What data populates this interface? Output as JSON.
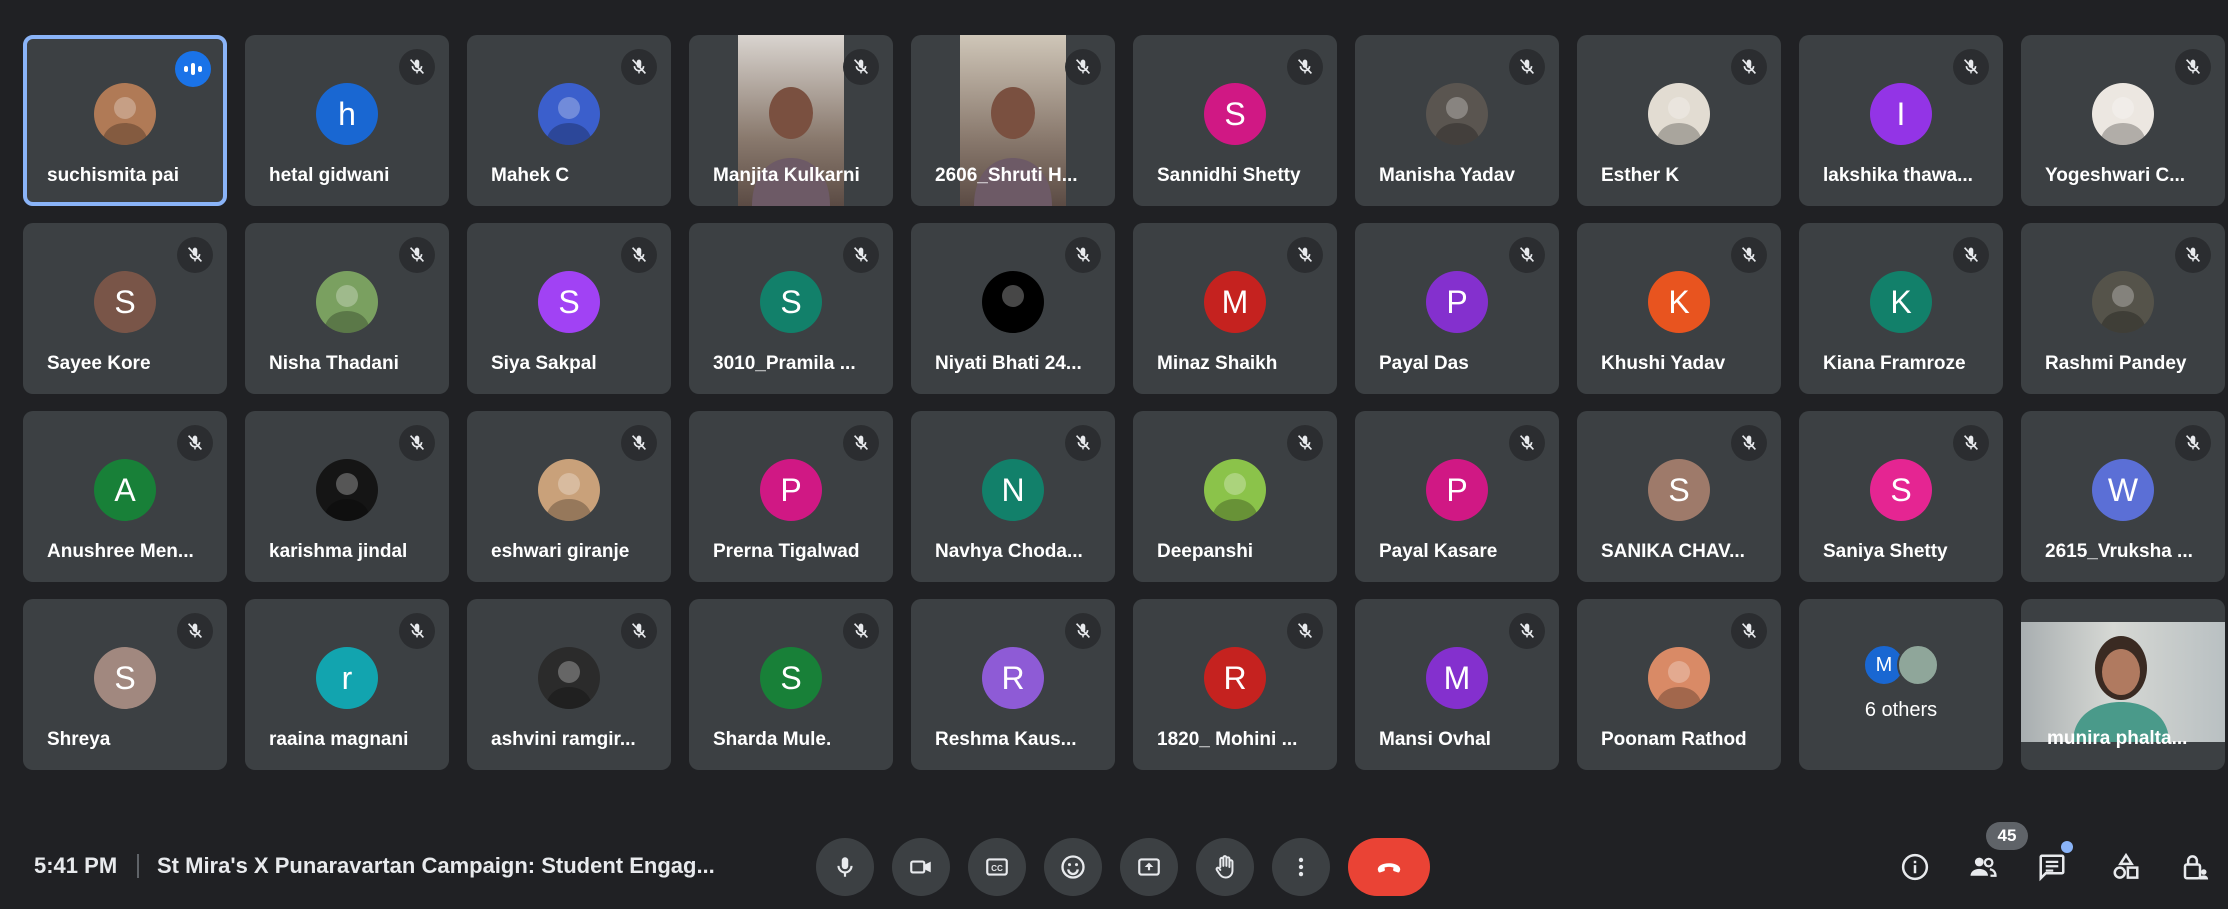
{
  "participants": [
    {
      "name": "suchismita pai",
      "avatar": "photo",
      "color": "#b07a56",
      "active": true,
      "speaking": true
    },
    {
      "name": "hetal gidwani",
      "initial": "h",
      "color": "#1967d2"
    },
    {
      "name": "Mahek C",
      "avatar": "photo",
      "color": "#3b5fcc"
    },
    {
      "name": "Manjita Kulkarni",
      "avatar": "video",
      "color": "#d9d4cf"
    },
    {
      "name": "2606_Shruti H...",
      "avatar": "video",
      "color": "#cfc6b8"
    },
    {
      "name": "Sannidhi Shetty",
      "initial": "S",
      "color": "#d01884"
    },
    {
      "name": "Manisha Yadav",
      "avatar": "photo",
      "color": "#5a5550"
    },
    {
      "name": "Esther K",
      "avatar": "photo",
      "color": "#e2dcd2"
    },
    {
      "name": "lakshika thawa...",
      "initial": "I",
      "color": "#9334e6"
    },
    {
      "name": "Yogeshwari C...",
      "avatar": "photo",
      "color": "#ece7e1"
    },
    {
      "name": "Sayee Kore",
      "initial": "S",
      "color": "#795548"
    },
    {
      "name": "Nisha Thadani",
      "avatar": "photo",
      "color": "#7aa060"
    },
    {
      "name": "Siya Sakpal",
      "initial": "S",
      "color": "#a142f4"
    },
    {
      "name": "3010_Pramila ...",
      "initial": "S",
      "color": "#12806a"
    },
    {
      "name": "Niyati Bhati 24...",
      "avatar": "photo",
      "color": "#000000"
    },
    {
      "name": "Minaz Shaikh",
      "initial": "M",
      "color": "#c5221f"
    },
    {
      "name": "Payal Das",
      "initial": "P",
      "color": "#8430ce"
    },
    {
      "name": "Khushi Yadav",
      "initial": "K",
      "color": "#e8541f"
    },
    {
      "name": "Kiana Framroze",
      "initial": "K",
      "color": "#12806a"
    },
    {
      "name": "Rashmi Pandey",
      "avatar": "photo",
      "color": "#55534a"
    },
    {
      "name": "Anushree Men...",
      "initial": "A",
      "color": "#188038"
    },
    {
      "name": "karishma jindal",
      "avatar": "photo",
      "color": "#151515"
    },
    {
      "name": "eshwari giranje",
      "avatar": "photo",
      "color": "#c9a17a"
    },
    {
      "name": "Prerna Tigalwad",
      "initial": "P",
      "color": "#d01884"
    },
    {
      "name": "Navhya Choda...",
      "initial": "N",
      "color": "#12806a"
    },
    {
      "name": "Deepanshi",
      "avatar": "photo",
      "color": "#8bc34a"
    },
    {
      "name": "Payal Kasare",
      "initial": "P",
      "color": "#d01884"
    },
    {
      "name": "SANIKA CHAV...",
      "initial": "S",
      "color": "#9e7a6a"
    },
    {
      "name": "Saniya Shetty",
      "initial": "S",
      "color": "#e52592"
    },
    {
      "name": "2615_Vruksha ...",
      "initial": "W",
      "color": "#5b6fd6"
    },
    {
      "name": "Shreya",
      "initial": "S",
      "color": "#a1887f"
    },
    {
      "name": "raaina magnani",
      "initial": "r",
      "color": "#12a4af"
    },
    {
      "name": "ashvini ramgir...",
      "avatar": "photo",
      "color": "#2b2b2b"
    },
    {
      "name": "Sharda Mule.",
      "initial": "S",
      "color": "#188038"
    },
    {
      "name": "Reshma Kaus...",
      "initial": "R",
      "color": "#8e5bd6"
    },
    {
      "name": "1820_ Mohini ...",
      "initial": "R",
      "color": "#c5221f"
    },
    {
      "name": "Mansi Ovhal",
      "initial": "M",
      "color": "#8430ce"
    },
    {
      "name": "Poonam Rathod",
      "avatar": "photo",
      "color": "#d98a66"
    }
  ],
  "others": {
    "label": "6 others",
    "initial": "M",
    "initial_color": "#1967d2"
  },
  "self": {
    "name": "munira phalta..."
  },
  "bottombar": {
    "time": "5:41 PM",
    "meeting_title": "St Mira's X Punaravartan Campaign: Student Engag...",
    "people_count": "45"
  }
}
